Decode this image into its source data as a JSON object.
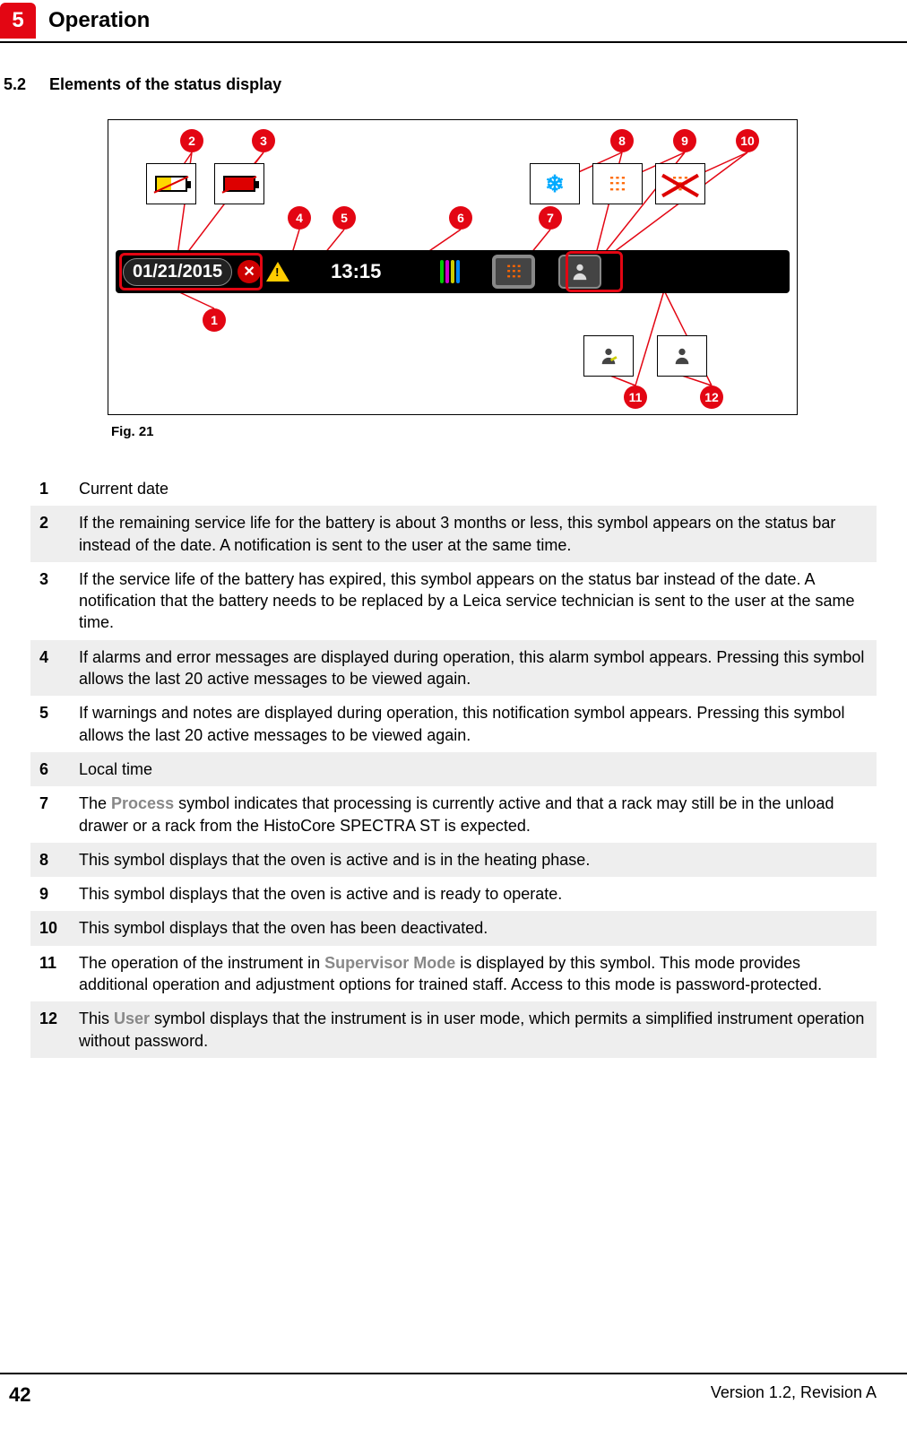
{
  "header": {
    "chapter_number": "5",
    "chapter_title": "Operation"
  },
  "section": {
    "number": "5.2",
    "title": "Elements of the status display"
  },
  "figure": {
    "caption": "Fig.  21",
    "statusbar": {
      "date": "01/21/2015",
      "time": "13:15"
    },
    "callouts": [
      "1",
      "2",
      "3",
      "4",
      "5",
      "6",
      "7",
      "8",
      "9",
      "10",
      "11",
      "12"
    ]
  },
  "items": [
    {
      "n": "1",
      "text": "Current date"
    },
    {
      "n": "2",
      "text": "If the remaining service life for the battery is about 3 months or less, this symbol appears on the status bar instead of the date. A notification is sent to the user at the same time."
    },
    {
      "n": "3",
      "text": "If the service life of the battery has expired, this symbol appears on the status bar instead of the date. A notification that the battery needs to be replaced by a Leica service technician is sent to the user at the same time."
    },
    {
      "n": "4",
      "text": "If alarms and error messages are displayed during operation, this alarm symbol appears. Pressing this symbol allows the last 20 active messages to be viewed again."
    },
    {
      "n": "5",
      "text": "If warnings and notes are displayed during operation, this notification symbol appears. Pressing this symbol allows the last 20 active messages to be viewed again."
    },
    {
      "n": "6",
      "text": "Local time"
    },
    {
      "n": "7",
      "html": "The <span class='kw'>Process</span> symbol indicates that processing is currently active and that a rack may still be in the unload drawer or a rack from the HistoCore SPECTRA ST is expected."
    },
    {
      "n": "8",
      "text": "This symbol displays that the oven is active and is in the heating phase."
    },
    {
      "n": "9",
      "text": "This symbol displays that the oven is active and is ready to operate."
    },
    {
      "n": "10",
      "text": "This symbol displays that the oven has been deactivated."
    },
    {
      "n": "11",
      "html": "The operation of the instrument in <span class='kw'>Supervisor Mode</span> is displayed by this symbol. This mode provides additional operation and adjustment options for trained staff. Access to this mode is password-protected."
    },
    {
      "n": "12",
      "html": "This <span class='kw'>User</span> symbol displays that the instrument is in user mode, which permits a simplified instrument operation without password."
    }
  ],
  "footer": {
    "page": "42",
    "version": "Version 1.2, Revision A"
  }
}
